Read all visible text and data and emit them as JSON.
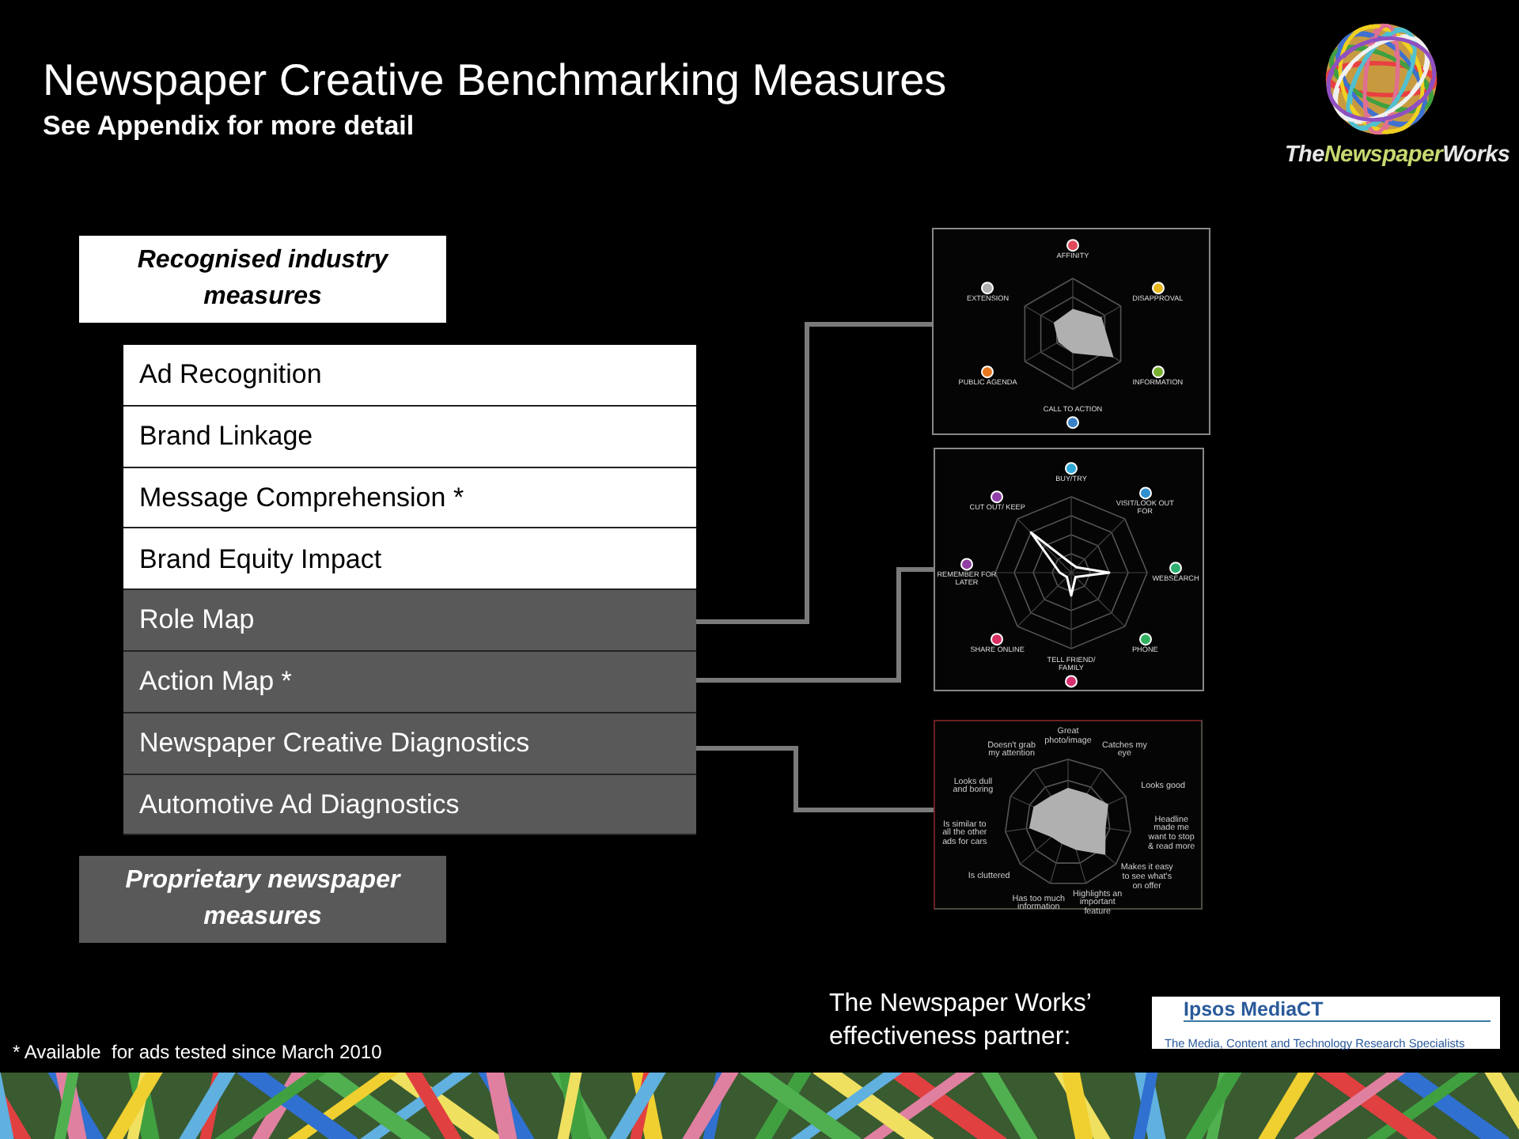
{
  "header": {
    "title": "Newspaper Creative Benchmarking Measures",
    "subtitle": "See Appendix for more detail"
  },
  "logo": {
    "wordmark": [
      "The",
      "Newspaper",
      "Works"
    ]
  },
  "measures": {
    "industry_label": "Recognised industry measures",
    "proprietary_label": "Proprietary newspaper measures",
    "rows": [
      {
        "label": "Ad Recognition",
        "kind": "industry"
      },
      {
        "label": "Brand Linkage",
        "kind": "industry"
      },
      {
        "label": "Message Comprehension *",
        "kind": "industry"
      },
      {
        "label": "Brand Equity Impact",
        "kind": "industry"
      },
      {
        "label": "Role Map",
        "kind": "proprietary"
      },
      {
        "label": "Action Map *",
        "kind": "proprietary"
      },
      {
        "label": "Newspaper Creative Diagnostics",
        "kind": "proprietary"
      },
      {
        "label": "Automotive Ad Diagnostics",
        "kind": "proprietary"
      }
    ]
  },
  "charts": [
    {
      "kind": "role_map",
      "axes": [
        {
          "label": "AFFINITY",
          "color": "#e04a5a"
        },
        {
          "label": "EXTENSION",
          "color": "#b0b0b0"
        },
        {
          "label": "DISAPPROVAL",
          "color": "#e8b820"
        },
        {
          "label": "PUBLIC AGENDA",
          "color": "#e87820"
        },
        {
          "label": "INFORMATION",
          "color": "#7ab030"
        },
        {
          "label": "CALL TO ACTION",
          "color": "#3a80c8"
        }
      ]
    },
    {
      "kind": "action_map",
      "axes": [
        {
          "label": "BUY/TRY",
          "color": "#30a8d8"
        },
        {
          "label": "CUT OUT/ KEEP",
          "color": "#9040a8"
        },
        {
          "label": "VISIT/LOOK OUT FOR",
          "color": "#3090d0"
        },
        {
          "label": "REMEMBER FOR LATER",
          "color": "#9040a0"
        },
        {
          "label": "WEBSEARCH",
          "color": "#30b070"
        },
        {
          "label": "SHARE ONLINE",
          "color": "#d83060"
        },
        {
          "label": "PHONE",
          "color": "#30b060"
        },
        {
          "label": "TELL FRIEND/ FAMILY",
          "color": "#d83070"
        }
      ]
    },
    {
      "kind": "diagnostics",
      "axes": [
        {
          "label": "Great photo/image"
        },
        {
          "label": "Doesn't grab my attention"
        },
        {
          "label": "Catches my eye"
        },
        {
          "label": "Looks dull and boring"
        },
        {
          "label": "Looks good"
        },
        {
          "label": "Is similar to all the other ads for cars"
        },
        {
          "label": "Headline made me want to stop & read more"
        },
        {
          "label": "Is cluttered"
        },
        {
          "label": "Makes it easy to see what's on offer"
        },
        {
          "label": "Has too much information"
        },
        {
          "label": "Highlights an important feature"
        }
      ]
    }
  ],
  "footnote": "* Available  for ads tested since March 2010",
  "partner": {
    "text": "The Newspaper Works’ effectiveness partner:",
    "logo_name": "Ipsos MediaCT",
    "logo_tagline": "The Media, Content and Technology Research Specialists"
  }
}
